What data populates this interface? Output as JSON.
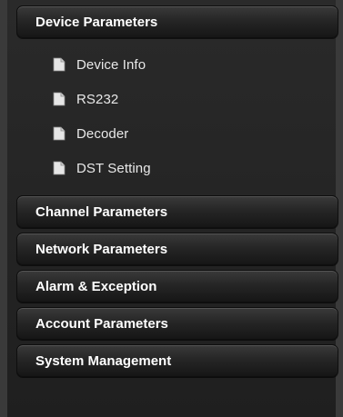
{
  "menu": {
    "device": {
      "title": "Device Parameters",
      "items": [
        {
          "label": "Device Info",
          "icon": "document-icon"
        },
        {
          "label": "RS232",
          "icon": "document-icon"
        },
        {
          "label": "Decoder",
          "icon": "document-icon"
        },
        {
          "label": "DST Setting",
          "icon": "document-icon"
        }
      ]
    },
    "sections": [
      {
        "title": "Channel Parameters"
      },
      {
        "title": "Network Parameters"
      },
      {
        "title": "Alarm & Exception"
      },
      {
        "title": "Account Parameters"
      },
      {
        "title": "System Management"
      }
    ]
  },
  "colors": {
    "header_text": "#ffffff",
    "item_text": "#e8e8e8",
    "background": "#1f1f1f"
  }
}
